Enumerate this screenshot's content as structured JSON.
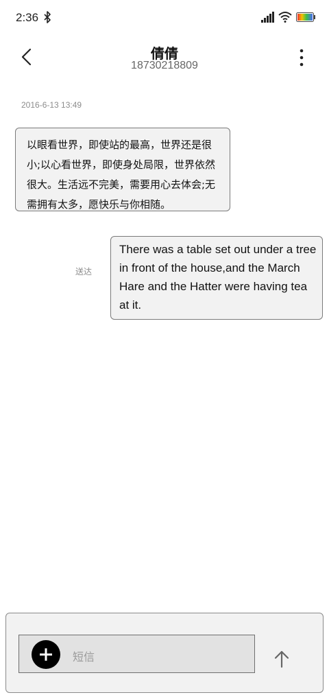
{
  "status_bar": {
    "time": "2:36",
    "icons": [
      "bluetooth-icon",
      "signal-icon",
      "wifi-icon",
      "battery-icon"
    ]
  },
  "header": {
    "contact_name": "倩倩",
    "contact_number": "18730218809",
    "back_icon": "chevron-left-icon",
    "more_icon": "more-vertical-icon"
  },
  "conversation": {
    "timestamp": "2016-6-13 13:49",
    "messages": [
      {
        "direction": "incoming",
        "text": "以眼看世界，即使站的最高，世界还是很小;以心看世界，即使身处局限，世界依然很大。生活远不完美，需要用心去体会;无需拥有太多，愿快乐与你相随。"
      },
      {
        "direction": "outgoing",
        "text": "There was a table set out under a tree in front of the house,and the March Hare and the Hatter were having tea at it.",
        "status": "送达"
      }
    ]
  },
  "composer": {
    "placeholder": "短信",
    "add_icon": "plus-icon",
    "send_icon": "arrow-up-icon"
  },
  "colors": {
    "bubble_background": "#f2f2f2",
    "bubble_border": "#7a7a7a",
    "add_button": "#000000",
    "secondary_text": "#8c8c8c"
  }
}
